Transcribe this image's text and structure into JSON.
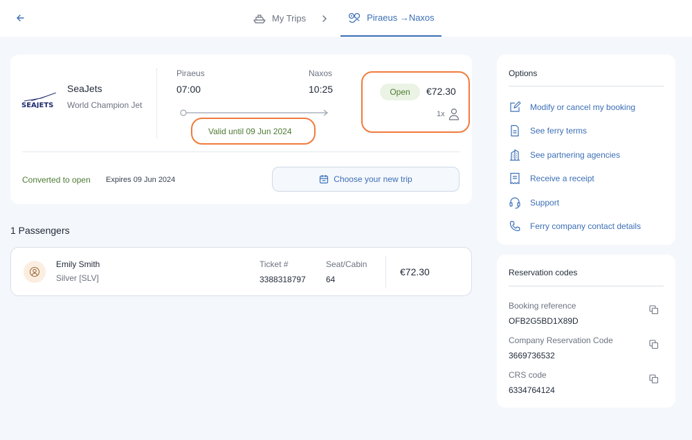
{
  "nav": {
    "my_trips": "My Trips",
    "route": "Piraeus →Naxos"
  },
  "trip": {
    "logo_text": "SEAJETS",
    "company": "SeaJets",
    "vessel": "World Champion Jet",
    "from_port": "Piraeus",
    "from_time": "07:00",
    "to_port": "Naxos",
    "to_time": "10:25",
    "validity": "Valid until 09 Jun 2024",
    "status": "Open",
    "price": "€72.30",
    "quantity": "1x",
    "converted": "Converted to open",
    "expires": "Expires 09 Jun 2024",
    "choose_button": "Choose your new trip"
  },
  "passengers": {
    "title": "1 Passengers",
    "list": [
      {
        "name": "Emily Smith",
        "class": "Silver [SLV]",
        "ticket_label": "Ticket #",
        "ticket": "3388318797",
        "seat_label": "Seat/Cabin",
        "seat": "64",
        "price": "€72.30"
      }
    ]
  },
  "options": {
    "title": "Options",
    "items": [
      {
        "label": "Modify or cancel my booking",
        "icon": "edit-icon"
      },
      {
        "label": "See ferry terms",
        "icon": "document-icon"
      },
      {
        "label": "See partnering agencies",
        "icon": "building-icon"
      },
      {
        "label": "Receive a receipt",
        "icon": "receipt-icon"
      },
      {
        "label": "Support",
        "icon": "headset-icon"
      },
      {
        "label": "Ferry company contact details",
        "icon": "phone-icon"
      }
    ]
  },
  "codes": {
    "title": "Reservation codes",
    "items": [
      {
        "label": "Booking reference",
        "value": "OFB2G5BD1X89D"
      },
      {
        "label": "Company Reservation Code",
        "value": "3669736532"
      },
      {
        "label": "CRS code",
        "value": "6334764124"
      }
    ]
  },
  "colors": {
    "accent": "#3b6fb6",
    "status_green": "#4d7a32",
    "highlight": "#f07a3a"
  }
}
